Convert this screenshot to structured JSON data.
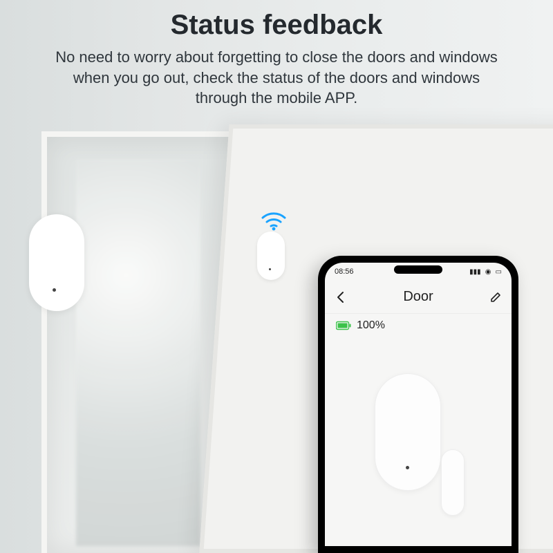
{
  "header": {
    "title": "Status feedback",
    "subtitle": "No need to worry about forgetting to close the doors and windows when you go out, check the status of the doors and windows through the mobile APP."
  },
  "phone": {
    "status_time": "08:56",
    "app_title": "Door",
    "battery_pct": "100%"
  },
  "colors": {
    "wifi": "#1aa3ff",
    "battery": "#3cc24a"
  }
}
